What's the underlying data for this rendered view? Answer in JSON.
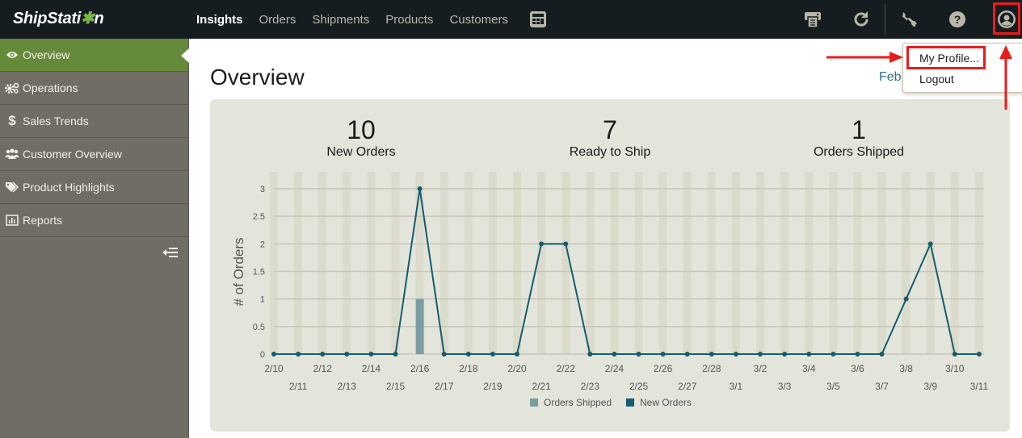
{
  "app": {
    "logo_text_a": "ShipStati",
    "logo_text_b": "n",
    "logo_gear": "✱"
  },
  "nav": {
    "items": [
      {
        "label": "Insights",
        "active": true
      },
      {
        "label": "Orders"
      },
      {
        "label": "Shipments"
      },
      {
        "label": "Products"
      },
      {
        "label": "Customers"
      }
    ],
    "icons": [
      "calculator-icon",
      "printer-icon",
      "refresh-icon",
      "wrench-icon",
      "help-icon",
      "user-profile-icon"
    ]
  },
  "sidebar": {
    "items": [
      {
        "label": "Overview",
        "icon": "eye-icon",
        "active": true
      },
      {
        "label": "Operations",
        "icon": "gears-icon"
      },
      {
        "label": "Sales Trends",
        "icon": "dollar-icon"
      },
      {
        "label": "Customer Overview",
        "icon": "users-icon"
      },
      {
        "label": "Product Highlights",
        "icon": "tags-icon"
      },
      {
        "label": "Reports",
        "icon": "bar-chart-icon"
      }
    ],
    "collapse_icon": "collapse-sidebar-icon"
  },
  "main": {
    "title": "Overview",
    "date_range_partial": "Feb"
  },
  "stats": [
    {
      "value": "10",
      "label": "New Orders"
    },
    {
      "value": "7",
      "label": "Ready to Ship"
    },
    {
      "value": "1",
      "label": "Orders Shipped"
    }
  ],
  "profile_menu": {
    "items": [
      {
        "label": "My Profile...",
        "highlighted": true
      },
      {
        "label": "Logout"
      }
    ]
  },
  "colors": {
    "accent_green": "#648a3a",
    "line_color": "#155c70",
    "bar_color": "#7a9da3",
    "annotation_red": "#e81c1c"
  },
  "chart_data": {
    "type": "line",
    "title": "",
    "xlabel": "",
    "ylabel": "# of Orders",
    "ylim": [
      0,
      3
    ],
    "yticks": [
      "0",
      "0.5",
      "1",
      "1.5",
      "2",
      "2.5",
      "3"
    ],
    "grid": true,
    "legend_position": "bottom",
    "x": [
      "2/10",
      "2/11",
      "2/12",
      "2/13",
      "2/14",
      "2/15",
      "2/16",
      "2/17",
      "2/18",
      "2/19",
      "2/20",
      "2/21",
      "2/22",
      "2/23",
      "2/24",
      "2/25",
      "2/26",
      "2/27",
      "2/28",
      "3/1",
      "3/2",
      "3/3",
      "3/4",
      "3/5",
      "3/6",
      "3/7",
      "3/8",
      "3/9",
      "3/10",
      "3/11"
    ],
    "series": [
      {
        "name": "Orders Shipped",
        "type": "bar",
        "values": [
          0,
          0,
          0,
          0,
          0,
          0,
          1,
          0,
          0,
          0,
          0,
          0,
          0,
          0,
          0,
          0,
          0,
          0,
          0,
          0,
          0,
          0,
          0,
          0,
          0,
          0,
          0,
          0,
          0,
          0
        ]
      },
      {
        "name": "New Orders",
        "type": "line",
        "values": [
          0,
          0,
          0,
          0,
          0,
          0,
          3,
          0,
          0,
          0,
          0,
          2,
          2,
          0,
          0,
          0,
          0,
          0,
          0,
          0,
          0,
          0,
          0,
          0,
          0,
          0,
          1,
          2,
          0,
          0
        ]
      }
    ]
  }
}
